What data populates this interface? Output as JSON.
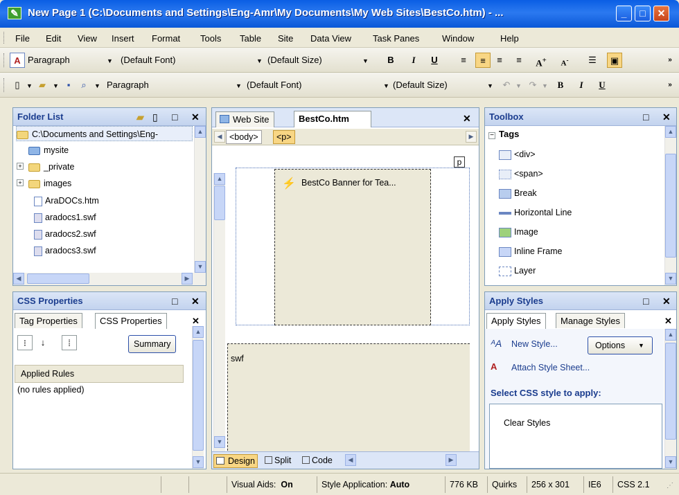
{
  "window": {
    "title": "New Page 1 (C:\\Documents and Settings\\Eng-Amr\\My Documents\\My Web Sites\\BestCo.htm) - ..."
  },
  "menu": [
    "File",
    "Edit",
    "View",
    "Insert",
    "Format",
    "Tools",
    "Table",
    "Site",
    "Data View",
    "Task Panes",
    "Window",
    "Help"
  ],
  "toolbar1": {
    "style": "Paragraph",
    "font": "(Default Font)",
    "size": "(Default Size)",
    "bold": "B",
    "italic": "I",
    "underline": "U"
  },
  "toolbar2": {
    "style": "Paragraph",
    "font": "(Default Font)",
    "size": "(Default Size)",
    "bold": "B",
    "italic": "I",
    "underline": "U"
  },
  "folder_list": {
    "title": "Folder List",
    "items": [
      {
        "label": "C:\\Documents and Settings\\Eng-",
        "icon": "folder-open-icon"
      },
      {
        "label": "mysite",
        "icon": "site-folder-icon"
      },
      {
        "label": "_private",
        "icon": "folder-icon"
      },
      {
        "label": "images",
        "icon": "folder-icon"
      },
      {
        "label": "AraDOCs.htm",
        "icon": "html-file-icon"
      },
      {
        "label": "aradocs1.swf",
        "icon": "swf-file-icon"
      },
      {
        "label": "aradocs2.swf",
        "icon": "swf-file-icon"
      },
      {
        "label": "aradocs3.swf",
        "icon": "swf-file-icon"
      }
    ]
  },
  "css_props": {
    "title": "CSS Properties",
    "tab1": "Tag Properties",
    "tab2": "CSS Properties",
    "summary": "Summary",
    "applied_rules": "Applied Rules",
    "no_rules": "(no rules applied)"
  },
  "editor": {
    "tab_website": "Web Site",
    "tab_file": "BestCo.htm",
    "tag_body": "<body>",
    "tag_p": "<p>",
    "p_marker": "p",
    "banner": "BestCo Banner for Tea...",
    "swf": "swf",
    "view_design": "Design",
    "view_split": "Split",
    "view_code": "Code"
  },
  "toolbox": {
    "title": "Toolbox",
    "group": "Tags",
    "items": [
      "<div>",
      "<span>",
      "Break",
      "Horizontal Line",
      "Image",
      "Inline Frame",
      "Layer"
    ]
  },
  "apply_styles": {
    "title": "Apply Styles",
    "tab1": "Apply Styles",
    "tab2": "Manage Styles",
    "new_style": "New Style...",
    "options": "Options",
    "attach": "Attach Style Sheet...",
    "select_label": "Select CSS style to apply:",
    "clear": "Clear Styles"
  },
  "status": {
    "visual_aids_label": "Visual Aids:",
    "visual_aids": "On",
    "style_app_label": "Style Application:",
    "style_app": "Auto",
    "size": "776 KB",
    "mode": "Quirks",
    "dims": "256 x 301",
    "browser": "IE6",
    "css": "CSS 2.1"
  }
}
